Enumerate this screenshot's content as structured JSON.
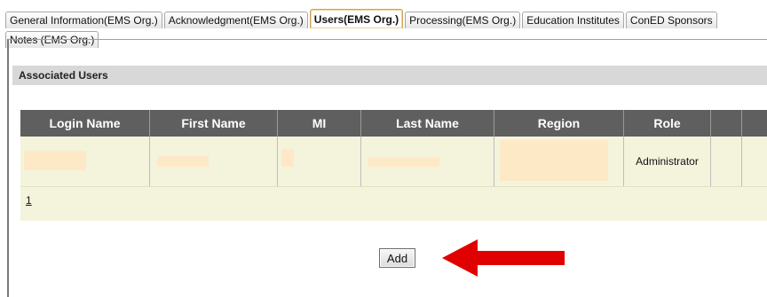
{
  "tabs": [
    {
      "label": "General Information(EMS Org.)"
    },
    {
      "label": "Acknowledgment(EMS Org.)"
    },
    {
      "label": "Users(EMS Org.)",
      "active": true
    },
    {
      "label": "Processing(EMS Org.)"
    },
    {
      "label": "Education Institutes"
    },
    {
      "label": "ConED Sponsors"
    },
    {
      "label": "Notes (EMS Org.)"
    }
  ],
  "section": {
    "title": "Associated Users"
  },
  "table": {
    "columns": [
      "Login Name",
      "First Name",
      "MI",
      "Last Name",
      "Region",
      "Role",
      "",
      ""
    ],
    "rows": [
      {
        "login_name": "",
        "first_name": "",
        "mi": "",
        "last_name": "",
        "region": "",
        "role": "Administrator"
      }
    ],
    "pager": {
      "page": "1"
    }
  },
  "actions": {
    "add_label": "Add"
  },
  "colors": {
    "header_bg": "#5f5f5f",
    "row_bg": "#f4f3dc",
    "redaction": "#fde9c6",
    "arrow": "#e00000",
    "section_bg": "#d8d8d8"
  },
  "annotation": {
    "icon": "red-arrow-left-icon"
  }
}
